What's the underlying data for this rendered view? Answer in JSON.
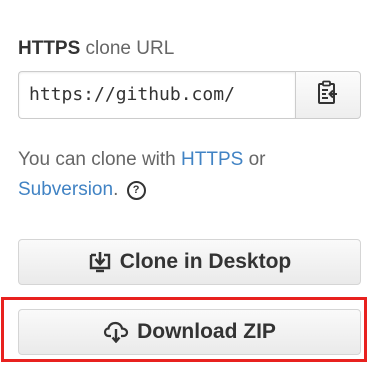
{
  "clone": {
    "protocol": "HTTPS",
    "label_rest": " clone URL",
    "url_value": "https://github.com/",
    "help_prefix": "You can clone with ",
    "help_https": "HTTPS",
    "help_or": " or",
    "help_subversion": "Subversion",
    "help_suffix": ".",
    "help_icon_glyph": "?"
  },
  "buttons": {
    "clone_desktop": "Clone in Desktop",
    "download_zip": "Download ZIP"
  },
  "icons": {
    "copy": "clipboard-icon",
    "desktop": "desktop-download-icon",
    "zip": "cloud-download-icon",
    "help": "question-circle-icon"
  },
  "colors": {
    "link": "#4183c4",
    "highlight": "#e8211f"
  }
}
